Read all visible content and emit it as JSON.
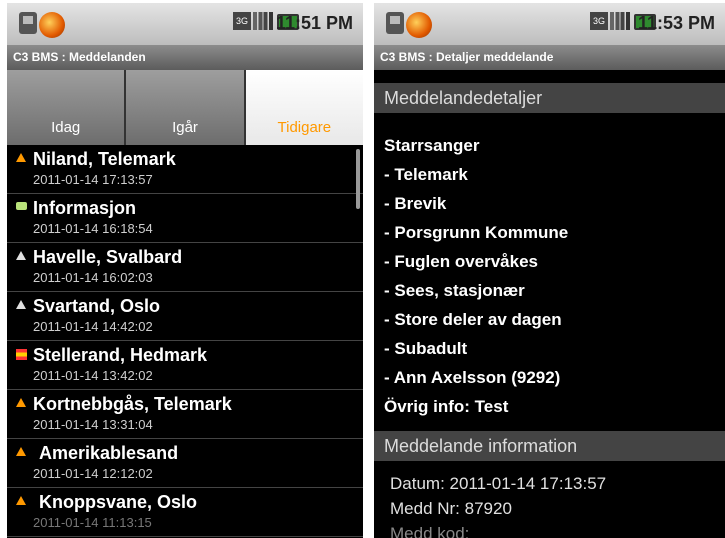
{
  "left": {
    "status": {
      "time": "11:51 PM",
      "network_label": "3G"
    },
    "title": "C3 BMS : Meddelanden",
    "tabs": [
      {
        "label": "Idag"
      },
      {
        "label": "Igår"
      },
      {
        "label": "Tidigare",
        "selected": true
      }
    ],
    "items": [
      {
        "name": "Niland, Telemark",
        "date": "2011-01-14 17:13:57",
        "icon": "orange-triangle-icon"
      },
      {
        "name": "Informasjon",
        "date": "2011-01-14 16:18:54",
        "icon": "envelope-icon"
      },
      {
        "name": "Havelle, Svalbard",
        "date": "2011-01-14 16:02:03",
        "icon": "white-triangle-icon"
      },
      {
        "name": "Svartand, Oslo",
        "date": "2011-01-14 14:42:02",
        "icon": "white-triangle-icon"
      },
      {
        "name": "Stellerand, Hedmark",
        "date": "2011-01-14 13:42:02",
        "icon": "red-yellow-flag-icon"
      },
      {
        "name": "Kortnebbgås, Telemark",
        "date": "2011-01-14 13:31:04",
        "icon": "orange-triangle-icon"
      },
      {
        "name": "Amerikablesand",
        "date": "2011-01-14 12:12:02",
        "icon": "orange-triangle-icon"
      },
      {
        "name": "Knoppsvane, Oslo",
        "date": "2011-01-14 11:13:15",
        "icon": "orange-triangle-icon"
      }
    ]
  },
  "right": {
    "status": {
      "time": "11:53 PM",
      "network_label": "3G"
    },
    "title": "C3 BMS : Detaljer meddelande",
    "details_header": "Meddelandedetaljer",
    "details": [
      "Starrsanger",
      "- Telemark",
      "- Brevik",
      "- Porsgrunn Kommune",
      "- Fuglen overvåkes",
      "- Sees, stasjonær",
      "- Store deler av dagen",
      "- Subadult",
      "- Ann Axelsson (9292)",
      "Övrig info: Test"
    ],
    "info_header": "Meddelande information",
    "info": [
      "Datum:  2011-01-14 17:13:57",
      "Medd Nr:  87920",
      "Medd kod:"
    ]
  },
  "colors": {
    "accent": "#ff9900",
    "background": "#000000"
  }
}
